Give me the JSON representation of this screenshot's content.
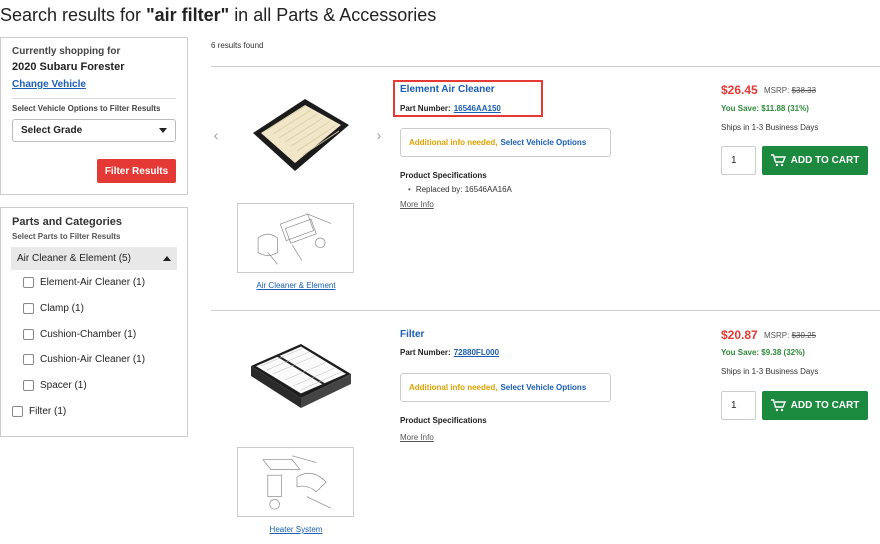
{
  "header": {
    "title_prefix": "Search results for",
    "query": "\"air filter\"",
    "title_suffix": "in all Parts & Accessories"
  },
  "vehicle": {
    "label": "Currently shopping for",
    "name": "2020 Subaru Forester",
    "change_link": "Change Vehicle",
    "options_label": "Select Vehicle Options to Filter Results",
    "grade_select": "Select Grade",
    "filter_button": "Filter Results"
  },
  "categories": {
    "title": "Parts and Categories",
    "subtitle": "Select Parts to Filter Results",
    "group": "Air Cleaner & Element (5)",
    "items": [
      "Element-Air Cleaner (1)",
      "Clamp (1)",
      "Cushion-Chamber (1)",
      "Cushion-Air Cleaner (1)",
      "Spacer (1)"
    ],
    "top_item": "Filter (1)"
  },
  "results": {
    "count": "6 results found",
    "items": [
      {
        "name": "Element Air Cleaner",
        "part_label": "Part Number:",
        "part_number": "16546AA150",
        "info_needed": "Additional info needed",
        "select_options": "Select Vehicle Options",
        "spec_title": "Product Specifications",
        "spec": "Replaced by: 16546AA16A",
        "more_info": "More Info",
        "price": "$26.45",
        "msrp_label": "MSRP:",
        "msrp": "$38.33",
        "save": "You Save: $11.88 (31%)",
        "ship": "Ships in 1-3 Business Days",
        "qty": "1",
        "cart": "ADD TO CART",
        "diagram": "Air Cleaner & Element"
      },
      {
        "name": "Filter",
        "part_label": "Part Number:",
        "part_number": "72880FL000",
        "info_needed": "Additional info needed",
        "select_options": "Select Vehicle Options",
        "spec_title": "Product Specifications",
        "more_info": "More Info",
        "price": "$20.87",
        "msrp_label": "MSRP:",
        "msrp": "$30.25",
        "save": "You Save: $9.38 (32%)",
        "ship": "Ships in 1-3 Business Days",
        "qty": "1",
        "cart": "ADD TO CART",
        "diagram": "Heater System"
      }
    ]
  },
  "colors": {
    "link": "#1a5fb4",
    "price": "#e53935",
    "save": "#2e8b3a",
    "cart": "#1b8a3e",
    "warning": "#e0a100"
  }
}
